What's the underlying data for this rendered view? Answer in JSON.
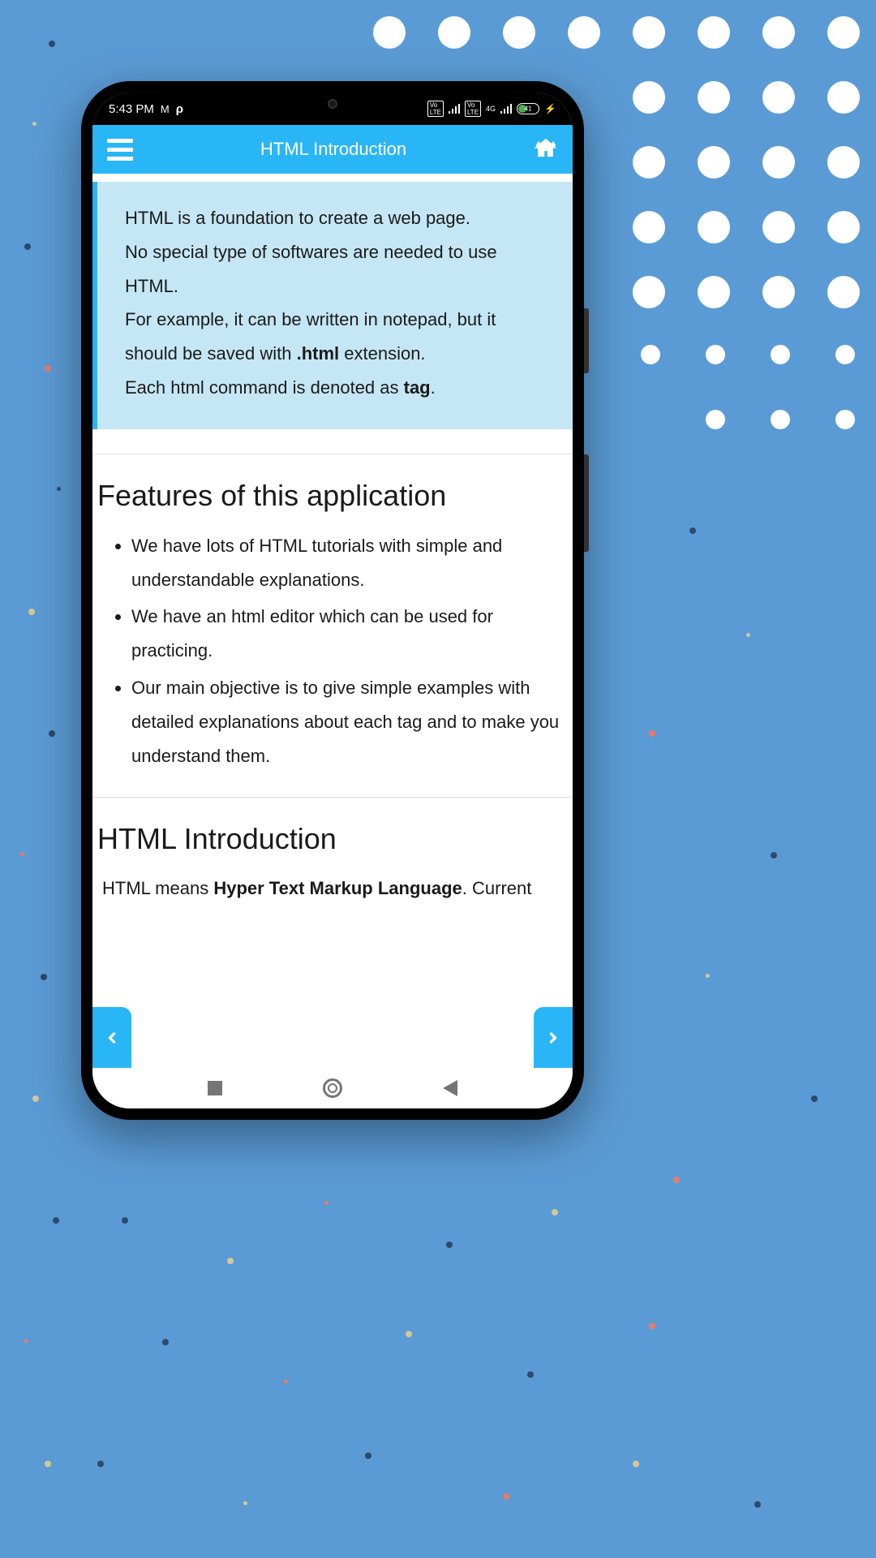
{
  "statusBar": {
    "time": "5:43 PM",
    "battery": "41"
  },
  "appBar": {
    "title": "HTML Introduction"
  },
  "infoBox": {
    "line1": "HTML is a foundation to create a web page.",
    "line2": "No special type of softwares are needed to use HTML.",
    "line3a": "For example, it can be written in notepad, but it should be saved with ",
    "line3bold": ".html",
    "line3b": " extension.",
    "line4a": "Each html command is denoted as ",
    "line4bold": "tag",
    "line4b": "."
  },
  "features": {
    "heading": "Features of this application",
    "items": [
      "We have lots of HTML tutorials with simple and understandable explanations.",
      "We have an html editor which can be used for practicing.",
      "Our main objective is to give simple examples with detailed explanations about each tag and to make you understand them."
    ]
  },
  "intro": {
    "heading": "HTML Introduction",
    "text_a": "HTML means ",
    "text_bold": "Hyper Text Markup Language",
    "text_b": ". Current"
  }
}
